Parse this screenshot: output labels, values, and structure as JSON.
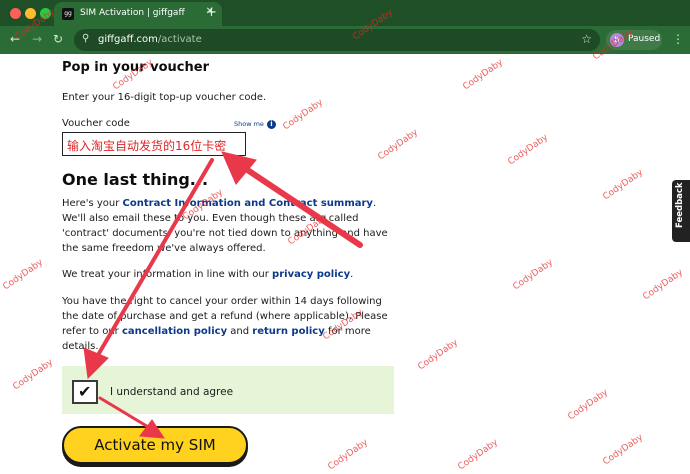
{
  "browser": {
    "tab_title": "SIM Activation | giffgaff",
    "tab_close": "✕",
    "new_tab": "+",
    "url_host": "giffgaff.com",
    "url_path": "/activate",
    "profile_initial": "b",
    "profile_status": "Paused"
  },
  "voucher": {
    "title": "Pop in your voucher",
    "description": "Enter your 16-digit top-up voucher code.",
    "field_label": "Voucher code",
    "show_me": "Show me",
    "input_value": "输入淘宝自动发货的16位卡密"
  },
  "last_thing": {
    "title": "One last thing...",
    "contract_pre": "Here's your ",
    "contract_link": "Contract Information and Contract summary",
    "contract_post": ". We'll also email these to you. Even though these are called 'contract' documents, you're not tied down to anything and have the same freedom we've always offered.",
    "privacy_pre": "We treat your information in line with our ",
    "privacy_link": "privacy policy",
    "privacy_post": ".",
    "cancel_pre": "You have the right to cancel your order within 14 days following the date of purchase and get a refund (where applicable). Please refer to our ",
    "cancel_link": "cancellation policy",
    "cancel_mid": " and ",
    "return_link": "return policy",
    "cancel_post": " for more details."
  },
  "agree": {
    "checked": true,
    "label": "I understand and agree"
  },
  "activate_button": "Activate my SIM",
  "feedback": "Feedback",
  "watermark": "CodyDaby",
  "colors": {
    "brand_green": "#2b6b35",
    "accent_yellow": "#ffd21f",
    "link_blue": "#0b3a8a",
    "annotation_red": "#e8384a",
    "agree_bg": "#e6f5d8"
  }
}
